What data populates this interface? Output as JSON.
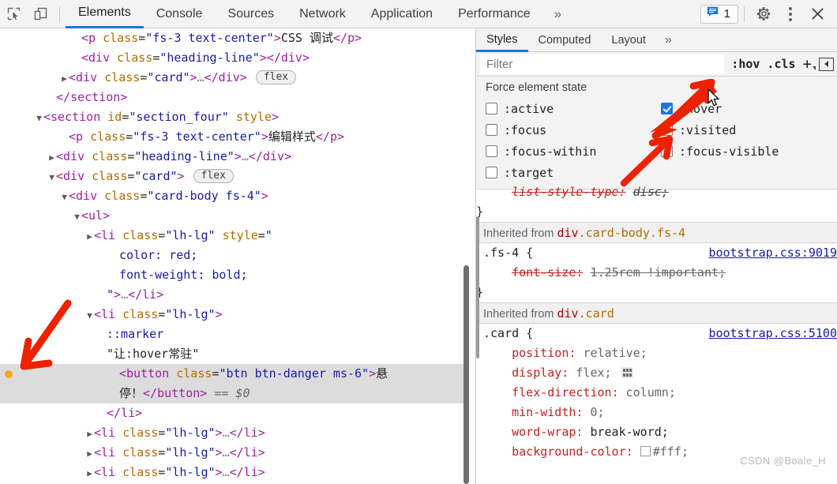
{
  "toolbar": {
    "inspect_icon": "inspect-element-icon",
    "device_icon": "device-toolbar-icon",
    "tabs": [
      {
        "label": "Elements",
        "active": true
      },
      {
        "label": "Console",
        "active": false
      },
      {
        "label": "Sources",
        "active": false
      },
      {
        "label": "Network",
        "active": false
      },
      {
        "label": "Application",
        "active": false
      },
      {
        "label": "Performance",
        "active": false
      }
    ],
    "more_tabs": "»",
    "message_count": "1",
    "message_icon": "message-bubble-icon",
    "settings_icon": "gear-icon",
    "kebab_icon": "more-options-icon",
    "close_icon": "close-icon",
    "accent_color": "#1a73e8"
  },
  "dom_tree": {
    "rows": [
      {
        "indent": 5,
        "twisty": "",
        "html": "<span class=\"punc\">&lt;</span><span class=\"tag\">p</span> <span class=\"attr\">class</span>=<span class=\"val\">\"fs-3 text-center\"</span><span class=\"punc\">&gt;</span><span class=\"txt\">CSS 调试</span><span class=\"punc\">&lt;/</span><span class=\"tag\">p</span><span class=\"punc\">&gt;</span>",
        "text": "<p class=\"fs-3 text-center\">CSS 调试</p>"
      },
      {
        "indent": 5,
        "twisty": "",
        "html": "<span class=\"punc\">&lt;</span><span class=\"tag\">div</span> <span class=\"attr\">class</span>=<span class=\"val\">\"heading-line\"</span><span class=\"punc\">&gt;&lt;/</span><span class=\"tag\">div</span><span class=\"punc\">&gt;</span>",
        "text": "<div class=\"heading-line\"></div>"
      },
      {
        "indent": 4,
        "twisty": "▶",
        "html": "<span class=\"punc\">&lt;</span><span class=\"tag\">div</span> <span class=\"attr\">class</span>=<span class=\"val\">\"card\"</span><span class=\"punc\">&gt;</span><span class=\"dim\">…</span><span class=\"punc\">&lt;/</span><span class=\"tag\">div</span><span class=\"punc\">&gt;</span> <span class=\"badge-flex\">flex</span>",
        "text": "<div class=\"card\">…</div> flex"
      },
      {
        "indent": 3,
        "twisty": "",
        "html": "<span class=\"punc\">&lt;/</span><span class=\"tag\">section</span><span class=\"punc\">&gt;</span>",
        "text": "</section>"
      },
      {
        "indent": 2,
        "twisty": "▼",
        "html": "<span class=\"punc\">&lt;</span><span class=\"tag\">section</span> <span class=\"attr\">id</span>=<span class=\"val\">\"section_four\"</span> <span class=\"attr\">style</span><span class=\"punc\">&gt;</span>",
        "text": "<section id=\"section_four\" style>"
      },
      {
        "indent": 4,
        "twisty": "",
        "html": "<span class=\"punc\">&lt;</span><span class=\"tag\">p</span> <span class=\"attr\">class</span>=<span class=\"val\">\"fs-3 text-center\"</span><span class=\"punc\">&gt;</span><span class=\"txt\">编辑样式</span><span class=\"punc\">&lt;/</span><span class=\"tag\">p</span><span class=\"punc\">&gt;</span>",
        "text": "<p class=\"fs-3 text-center\">编辑样式</p>"
      },
      {
        "indent": 3,
        "twisty": "▶",
        "html": "<span class=\"punc\">&lt;</span><span class=\"tag\">div</span> <span class=\"attr\">class</span>=<span class=\"val\">\"heading-line\"</span><span class=\"punc\">&gt;</span><span class=\"dim\">…</span><span class=\"punc\">&lt;/</span><span class=\"tag\">div</span><span class=\"punc\">&gt;</span>",
        "text": "<div class=\"heading-line\">…</div>"
      },
      {
        "indent": 3,
        "twisty": "▼",
        "html": "<span class=\"punc\">&lt;</span><span class=\"tag\">div</span> <span class=\"attr\">class</span>=<span class=\"val\">\"card\"</span><span class=\"punc\">&gt;</span> <span class=\"badge-flex\">flex</span>",
        "text": "<div class=\"card\"> flex"
      },
      {
        "indent": 4,
        "twisty": "▼",
        "html": "<span class=\"punc\">&lt;</span><span class=\"tag\">div</span> <span class=\"attr\">class</span>=<span class=\"val\">\"card-body fs-4\"</span><span class=\"punc\">&gt;</span>",
        "text": "<div class=\"card-body fs-4\">"
      },
      {
        "indent": 5,
        "twisty": "▼",
        "html": "<span class=\"punc\">&lt;</span><span class=\"tag\">ul</span><span class=\"punc\">&gt;</span>",
        "text": "<ul>"
      },
      {
        "indent": 6,
        "twisty": "▶",
        "html": "<span class=\"punc\">&lt;</span><span class=\"tag\">li</span> <span class=\"attr\">class</span>=<span class=\"val\">\"lh-lg\"</span> <span class=\"attr\">style</span>=<span class=\"val\">\"</span>",
        "text": "<li class=\"lh-lg\" style=\""
      },
      {
        "indent": 8,
        "twisty": "",
        "html": "<span class=\"cssprop\">color: red;</span>",
        "text": "color: red;"
      },
      {
        "indent": 8,
        "twisty": "",
        "html": "<span class=\"cssprop\">font-weight: bold;</span>",
        "text": "font-weight: bold;"
      },
      {
        "indent": 7,
        "twisty": "",
        "html": "<span class=\"val\">\"</span><span class=\"punc\">&gt;</span><span class=\"dim\">…</span><span class=\"punc\">&lt;/</span><span class=\"tag\">li</span><span class=\"punc\">&gt;</span>",
        "text": "\">…</li>"
      },
      {
        "indent": 6,
        "twisty": "▼",
        "html": "<span class=\"punc\">&lt;</span><span class=\"tag\">li</span> <span class=\"attr\">class</span>=<span class=\"val\">\"lh-lg\"</span><span class=\"punc\">&gt;</span>",
        "text": "<li class=\"lh-lg\">"
      },
      {
        "indent": 7,
        "twisty": "",
        "html": "<span class=\"pseudo\">::marker</span>",
        "text": "::marker"
      },
      {
        "indent": 7,
        "twisty": "",
        "html": "<span class=\"txt\">\"让:hover常驻\"</span>",
        "text": "\"让:hover常驻\""
      },
      {
        "indent": 8,
        "twisty": "",
        "selected": true,
        "breakpoint": true,
        "html": "<span class=\"punc\">&lt;</span><span class=\"tag\">button</span> <span class=\"attr\">class</span>=<span class=\"val\">\"btn btn-danger ms-6\"</span><span class=\"punc\">&gt;</span><span class=\"txt\">悬</span>",
        "text": "<button class=\"btn btn-danger ms-6\">悬"
      },
      {
        "indent": 8,
        "twisty": "",
        "selected": true,
        "html": "<span class=\"txt\">停！</span><span class=\"punc\">&lt;/</span><span class=\"tag\">button</span><span class=\"punc\">&gt;</span> <span class=\"dollar\">== $0</span>",
        "text": "停！</button> == $0"
      },
      {
        "indent": 7,
        "twisty": "",
        "html": "<span class=\"punc\">&lt;/</span><span class=\"tag\">li</span><span class=\"punc\">&gt;</span>",
        "text": "</li>"
      },
      {
        "indent": 6,
        "twisty": "▶",
        "html": "<span class=\"punc\">&lt;</span><span class=\"tag\">li</span> <span class=\"attr\">class</span>=<span class=\"val\">\"lh-lg\"</span><span class=\"punc\">&gt;</span><span class=\"dim\">…</span><span class=\"punc\">&lt;/</span><span class=\"tag\">li</span><span class=\"punc\">&gt;</span>",
        "text": "<li class=\"lh-lg\">…</li>"
      },
      {
        "indent": 6,
        "twisty": "▶",
        "html": "<span class=\"punc\">&lt;</span><span class=\"tag\">li</span> <span class=\"attr\">class</span>=<span class=\"val\">\"lh-lg\"</span><span class=\"punc\">&gt;</span><span class=\"dim\">…</span><span class=\"punc\">&lt;/</span><span class=\"tag\">li</span><span class=\"punc\">&gt;</span>",
        "text": "<li class=\"lh-lg\">…</li>"
      },
      {
        "indent": 6,
        "twisty": "▶",
        "html": "<span class=\"punc\">&lt;</span><span class=\"tag\">li</span> <span class=\"attr\">class</span>=<span class=\"val\">\"lh-lg\"</span><span class=\"punc\">&gt;</span><span class=\"dim\">…</span><span class=\"punc\">&lt;/</span><span class=\"tag\">li</span><span class=\"punc\">&gt;</span>",
        "text": "<li class=\"lh-lg\">…</li>"
      }
    ]
  },
  "styles": {
    "tabs": [
      {
        "label": "Styles",
        "active": true
      },
      {
        "label": "Computed",
        "active": false
      },
      {
        "label": "Layout",
        "active": false
      }
    ],
    "more_tabs": "»",
    "filter_placeholder": "Filter",
    "filter_value": "",
    "hov_button": ":hov",
    "cls_button": ".cls",
    "new_rule_button": "+",
    "force_state_title": "Force element state",
    "states": [
      {
        "label": ":active",
        "checked": false
      },
      {
        "label": ":hover",
        "checked": true
      },
      {
        "label": ":focus",
        "checked": false
      },
      {
        "label": ":visited",
        "checked": false
      },
      {
        "label": ":focus-within",
        "checked": false
      },
      {
        "label": ":focus-visible",
        "checked": false
      },
      {
        "label": ":target",
        "checked": false
      }
    ],
    "partial_rule_top": {
      "property": "list-style-type",
      "value": "disc",
      "overridden": true,
      "close_brace": "}"
    },
    "rules": [
      {
        "inherited_from_label": "Inherited from",
        "inherited_from_element": "div",
        "inherited_from_classes": ".card-body.fs-4",
        "selector": ".fs-4 {",
        "source": "bootstrap.css:9019",
        "declarations": [
          {
            "property": "font-size",
            "value": "1.25rem !important",
            "overridden": true
          }
        ],
        "close_brace": "}"
      },
      {
        "inherited_from_label": "Inherited from",
        "inherited_from_element": "div",
        "inherited_from_classes": ".card",
        "selector": ".card {",
        "source": "bootstrap.css:5100",
        "declarations": [
          {
            "property": "position",
            "value": "relative",
            "overridden": false
          },
          {
            "property": "display",
            "value": "flex",
            "overridden": false,
            "flex_badge": true
          },
          {
            "property": "flex-direction",
            "value": "column",
            "overridden": false
          },
          {
            "property": "min-width",
            "value": "0",
            "overridden": false
          },
          {
            "property": "word-wrap",
            "value": "break-word",
            "overridden": false,
            "emphasis": true
          },
          {
            "property": "background-color",
            "value": "#fff",
            "overridden": false,
            "swatch": "#ffffff"
          }
        ]
      }
    ]
  },
  "annotations": {
    "arrow_color": "#ee2200",
    "watermark": "CSDN @Boale_H",
    "cursor_icon": "mouse-pointer-icon"
  }
}
